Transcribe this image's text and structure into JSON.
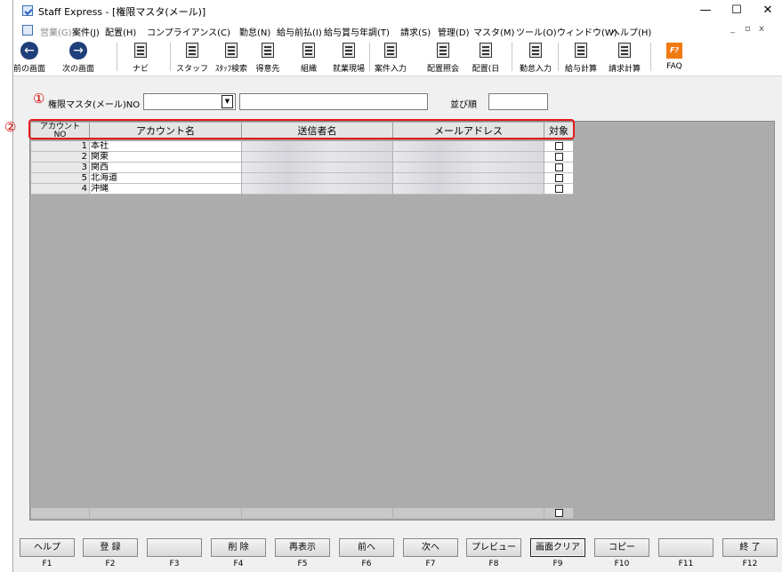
{
  "window": {
    "title": "Staff Express - [権限マスタ(メール)]",
    "min": "—",
    "max": "☐",
    "close": "✕"
  },
  "menu": {
    "items": [
      {
        "label": "営業(G)",
        "disabled": true
      },
      {
        "label": "案件(J)"
      },
      {
        "label": "配置(H)"
      },
      {
        "label": "コンプライアンス(C)"
      },
      {
        "label": "勤怠(N)"
      },
      {
        "label": "給与前払(I)"
      },
      {
        "label": "給与賞与年調(T)"
      },
      {
        "label": "請求(S)"
      },
      {
        "label": "管理(D)"
      },
      {
        "label": "マスタ(M)"
      },
      {
        "label": "ツール(O)"
      },
      {
        "label": "ウィンドウ(W)"
      },
      {
        "label": "ヘルプ(H)"
      }
    ],
    "mdi_controls": [
      "_",
      "▫",
      "x"
    ]
  },
  "toolbar": {
    "buttons": [
      {
        "label": "前の画面",
        "icon": "back-arrow-icon"
      },
      {
        "label": "次の画面",
        "icon": "forward-arrow-icon"
      },
      {
        "label": "ナビ",
        "icon": "navi-icon"
      },
      {
        "label": "スタッフ",
        "icon": "staff-icon"
      },
      {
        "label": "ｽﾀｯﾌ検索",
        "icon": "staff-search-icon"
      },
      {
        "label": "得意先",
        "icon": "client-icon"
      },
      {
        "label": "組織",
        "icon": "organization-icon"
      },
      {
        "label": "就業現場",
        "icon": "workplace-icon"
      },
      {
        "label": "案件入力",
        "icon": "case-entry-icon"
      },
      {
        "label": "配置照会",
        "icon": "placement-query-icon"
      },
      {
        "label": "配置(日",
        "icon": "placement-daily-icon"
      },
      {
        "label": "勤怠入力",
        "icon": "attendance-entry-icon"
      },
      {
        "label": "給与計算",
        "icon": "payroll-icon"
      },
      {
        "label": "請求計算",
        "icon": "billing-icon"
      },
      {
        "label": "FAQ",
        "icon": "faq-icon"
      }
    ]
  },
  "form": {
    "marker1": "①",
    "no_label": "権限マスタ(メール)NO",
    "no_value": "",
    "name_value": "",
    "order_label": "並び順",
    "order_value": "",
    "marker2": "②"
  },
  "grid": {
    "columns": [
      "アカウント\nNO",
      "アカウント名",
      "送信者名",
      "メールアドレス",
      "対象"
    ],
    "col_line1": "アカウント",
    "col_line2": "NO",
    "rows": [
      {
        "no": "1",
        "name": "本社",
        "checked": false
      },
      {
        "no": "2",
        "name": "関東",
        "checked": false
      },
      {
        "no": "3",
        "name": "関西",
        "checked": false
      },
      {
        "no": "5",
        "name": "北海道",
        "checked": false
      },
      {
        "no": "4",
        "name": "沖縄",
        "checked": false
      }
    ]
  },
  "fkeys": [
    {
      "label": "ヘルプ",
      "key": "F1"
    },
    {
      "label": "登 録",
      "key": "F2"
    },
    {
      "label": "",
      "key": "F3"
    },
    {
      "label": "削 除",
      "key": "F4"
    },
    {
      "label": "再表示",
      "key": "F5"
    },
    {
      "label": "前へ",
      "key": "F6"
    },
    {
      "label": "次へ",
      "key": "F7"
    },
    {
      "label": "プレビュー",
      "key": "F8"
    },
    {
      "label": "画面クリア",
      "key": "F9",
      "active": true
    },
    {
      "label": "コピー",
      "key": "F10"
    },
    {
      "label": "",
      "key": "F11"
    },
    {
      "label": "終 了",
      "key": "F12"
    }
  ]
}
